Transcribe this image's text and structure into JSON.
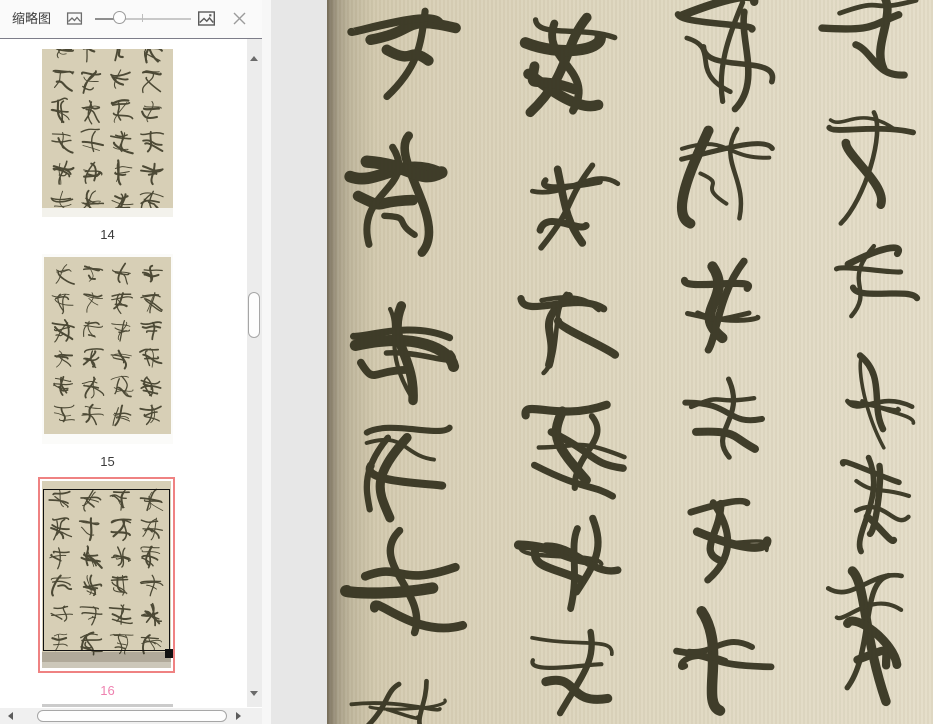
{
  "panel": {
    "title": "缩略图",
    "toolbar": {
      "shrink_thumbnails_icon": "image-small-icon",
      "enlarge_thumbnails_icon": "image-large-icon",
      "close_icon": "close-icon",
      "size_slider": {
        "value_percent": 26
      }
    },
    "thumbnails": [
      {
        "page": "14",
        "selected": false
      },
      {
        "page": "15",
        "selected": false
      },
      {
        "page": "16",
        "selected": true
      }
    ]
  },
  "viewer": {
    "content_description": "Chinese cursive (caoshu) brush calligraphy — four vertical columns of characters in dark ink on aged beige scroll paper; the currently selected page 16 zoomed to fill the view, dark book-fold edge along the left"
  },
  "colors": {
    "selection_border": "#ef8282",
    "active_page_number": "#ee82b0",
    "paper": "#ddd5bd",
    "ink": "#34321f",
    "viewer_background": "#e7e7e7",
    "toolbar_background": "#fafafa"
  }
}
